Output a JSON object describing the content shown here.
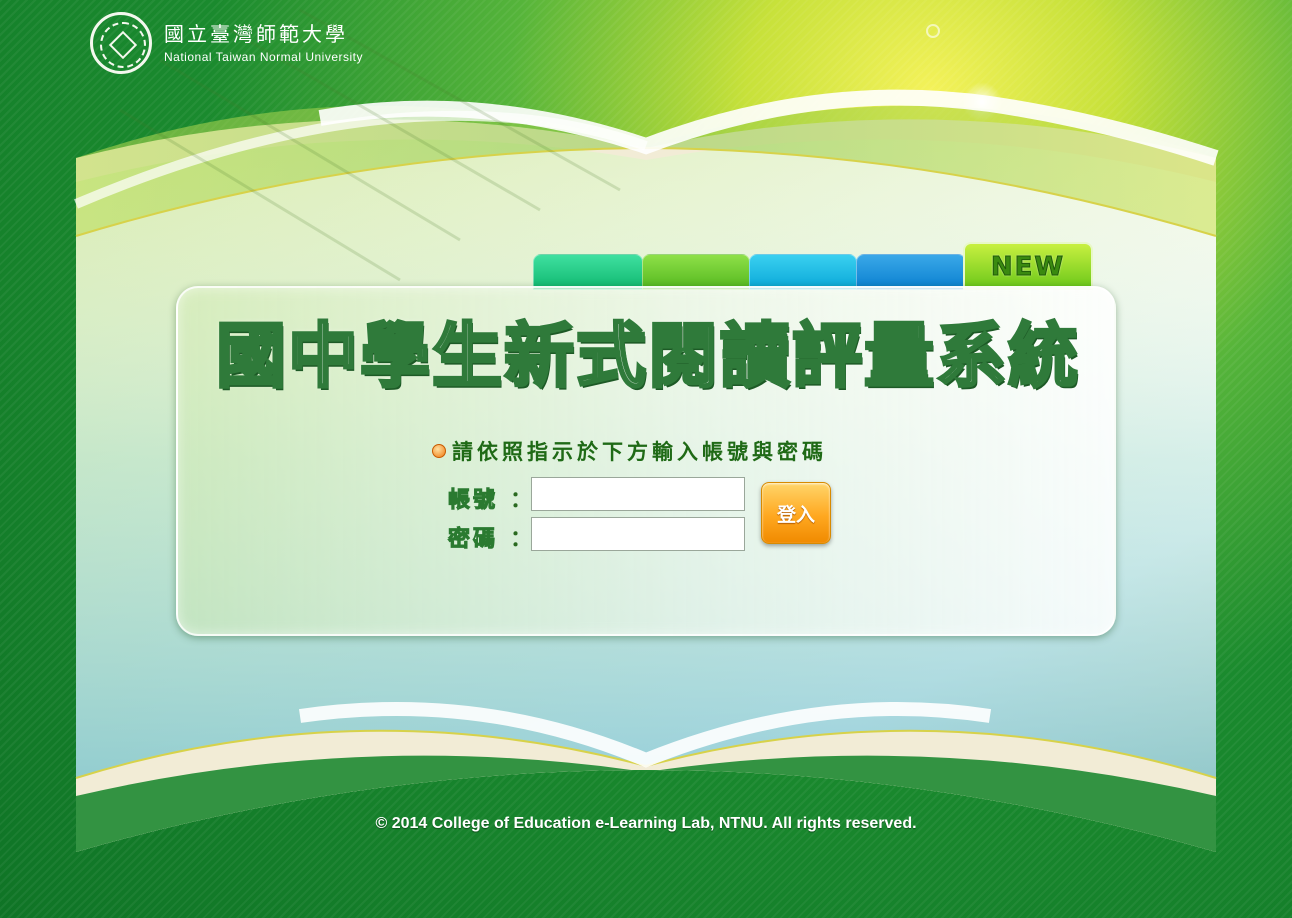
{
  "header": {
    "university_cn": "國立臺灣師範大學",
    "university_en": "National Taiwan Normal University"
  },
  "tabs": {
    "new_label": "NEW"
  },
  "main": {
    "title": "國中學生新式閱讀評量系統",
    "instruction": "請依照指示於下方輸入帳號與密碼"
  },
  "form": {
    "account_label": "帳號",
    "password_label": "密碼",
    "colon": "：",
    "account_value": "",
    "password_value": "",
    "login_label": "登入"
  },
  "footer": {
    "copyright": "© 2014 College of Education e-Learning Lab, NTNU. All rights reserved."
  },
  "colors": {
    "background_green": "#0f7426",
    "accent_yellow": "#f4f25a",
    "title_stroke": "#2f7a3a",
    "button_orange": "#ffa820"
  }
}
